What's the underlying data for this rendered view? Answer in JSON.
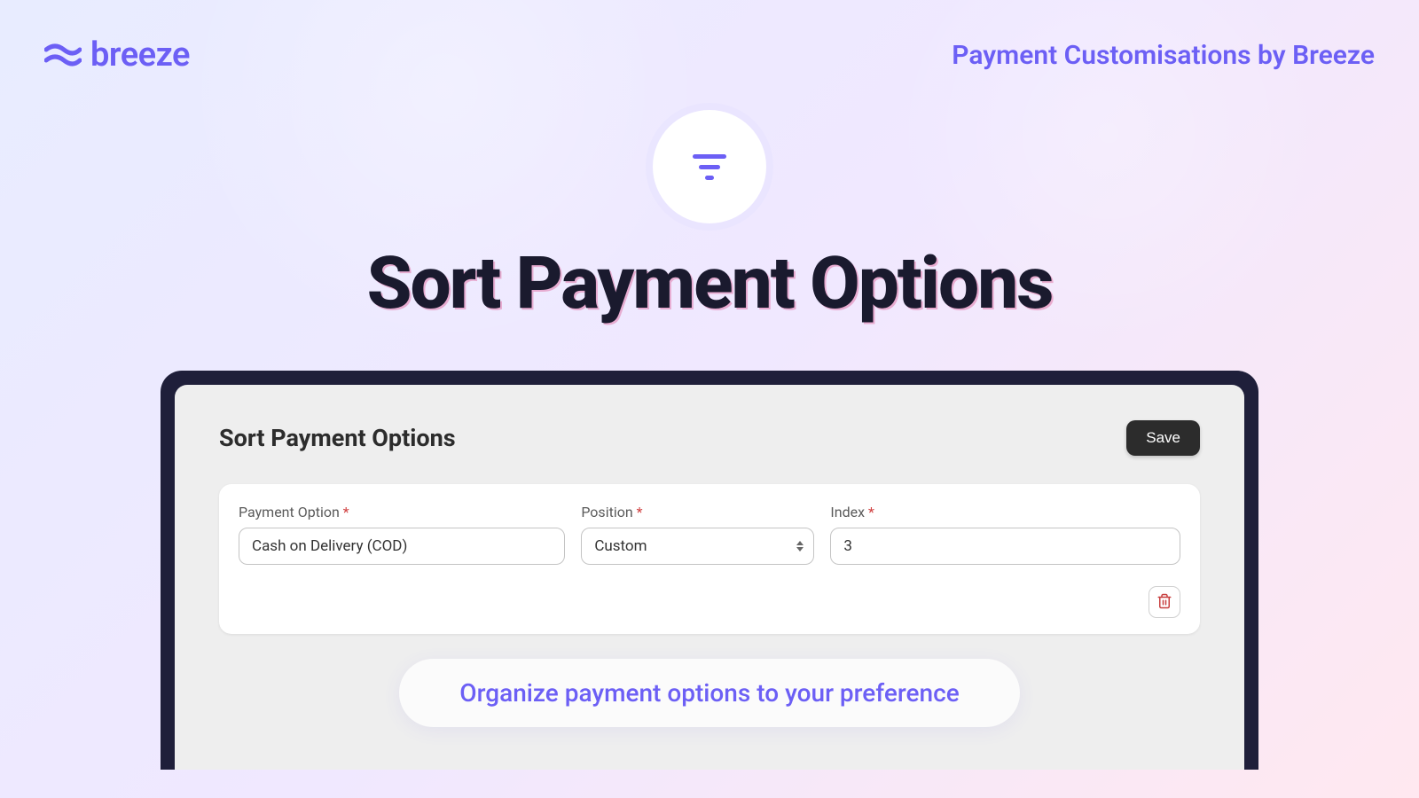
{
  "header": {
    "logo_text": "breeze",
    "tagline": "Payment Customisations by Breeze"
  },
  "hero": {
    "title": "Sort Payment Options"
  },
  "card": {
    "title": "Sort Payment Options",
    "save_label": "Save",
    "fields": {
      "payment_option": {
        "label": "Payment Option",
        "value": "Cash on Delivery (COD)"
      },
      "position": {
        "label": "Position",
        "selected": "Custom"
      },
      "index": {
        "label": "Index",
        "value": "3"
      }
    }
  },
  "footer": {
    "pill_text": "Organize payment options to your preference"
  }
}
